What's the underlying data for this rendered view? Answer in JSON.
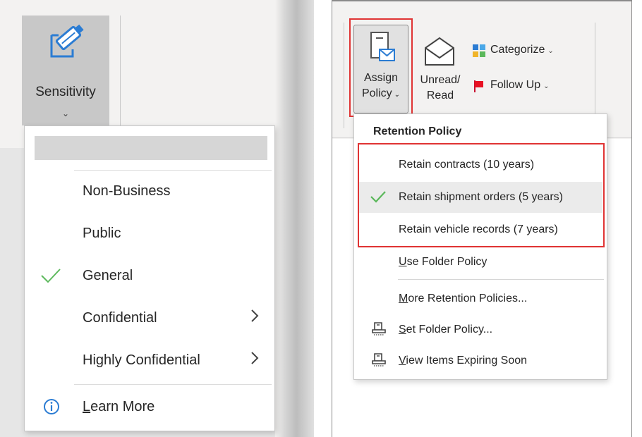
{
  "sensitivity": {
    "button_label": "Sensitivity",
    "menu_items": [
      {
        "label": "Non-Business",
        "checked": false,
        "submenu": false
      },
      {
        "label": "Public",
        "checked": false,
        "submenu": false
      },
      {
        "label": "General",
        "checked": true,
        "submenu": false
      },
      {
        "label": "Confidential",
        "checked": false,
        "submenu": true
      },
      {
        "label": "Highly Confidential",
        "checked": false,
        "submenu": true
      }
    ],
    "learn_more_label": "Learn More",
    "check_color": "#5bb85b",
    "info_icon_color": "#2b7cd3"
  },
  "ribbon": {
    "assign_policy": {
      "line1": "Assign",
      "line2": "Policy"
    },
    "unread_read": {
      "line1": "Unread/",
      "line2": "Read"
    },
    "categorize_label": "Categorize",
    "follow_up_label": "Follow Up"
  },
  "retention_menu": {
    "header": "Retention Policy",
    "policies": [
      {
        "label": "Retain contracts (10 years)",
        "checked": false
      },
      {
        "label": "Retain shipment orders (5 years)",
        "checked": true
      },
      {
        "label": "Retain vehicle records (7 years)",
        "checked": false
      }
    ],
    "use_folder_policy": "Use Folder Policy",
    "more_policies": "More Retention Policies...",
    "set_folder_policy": "Set Folder Policy...",
    "view_expiring": "View Items Expiring Soon",
    "highlight_color": "#e03434"
  }
}
